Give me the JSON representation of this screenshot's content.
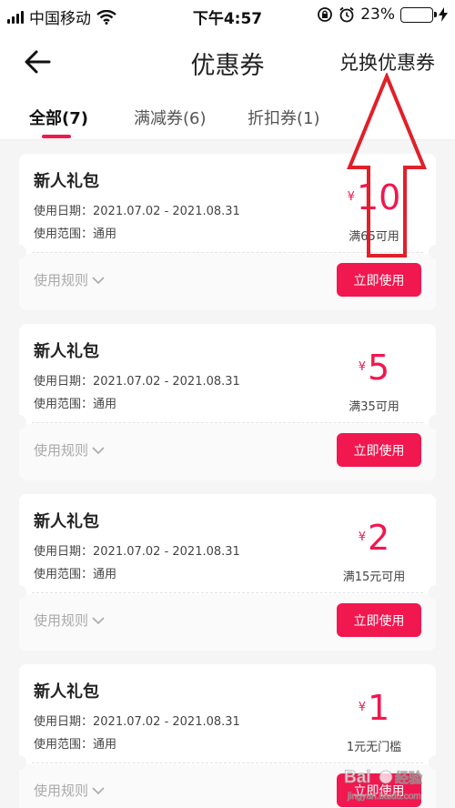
{
  "status_bar": {
    "carrier": "中国移动",
    "time": "下午4:57",
    "battery_percent": "23%",
    "battery_level": 0.23,
    "battery_color": "#36c23a"
  },
  "header": {
    "title": "优惠券",
    "back_icon": "arrow-left-icon",
    "redeem_label": "兑换优惠券"
  },
  "tabs": [
    {
      "label": "全部(7)",
      "active": true
    },
    {
      "label": "满减券(6)",
      "active": false
    },
    {
      "label": "折扣券(1)",
      "active": false
    }
  ],
  "coupons": [
    {
      "name": "新人礼包",
      "date": "使用日期：2021.07.02 - 2021.08.31",
      "scope": "使用范围：通用",
      "currency": "¥",
      "amount": "10",
      "condition": "满65可用",
      "rules_label": "使用规则",
      "button_label": "立即使用"
    },
    {
      "name": "新人礼包",
      "date": "使用日期：2021.07.02 - 2021.08.31",
      "scope": "使用范围：通用",
      "currency": "¥",
      "amount": "5",
      "condition": "满35可用",
      "rules_label": "使用规则",
      "button_label": "立即使用"
    },
    {
      "name": "新人礼包",
      "date": "使用日期：2021.07.02 - 2021.08.31",
      "scope": "使用范围：通用",
      "currency": "¥",
      "amount": "2",
      "condition": "满15元可用",
      "rules_label": "使用规则",
      "button_label": "立即使用"
    },
    {
      "name": "新人礼包",
      "date": "使用日期：2021.07.02 - 2021.08.31",
      "scope": "使用范围：通用",
      "currency": "¥",
      "amount": "1",
      "condition": "1元无门槛",
      "rules_label": "使用规则",
      "button_label": "立即使用"
    }
  ],
  "colors": {
    "accent": "#f0184f",
    "annotation": "#e0202a"
  },
  "watermark": {
    "text": "Bai度经验",
    "subtext": "jingyan.baidu.com"
  }
}
